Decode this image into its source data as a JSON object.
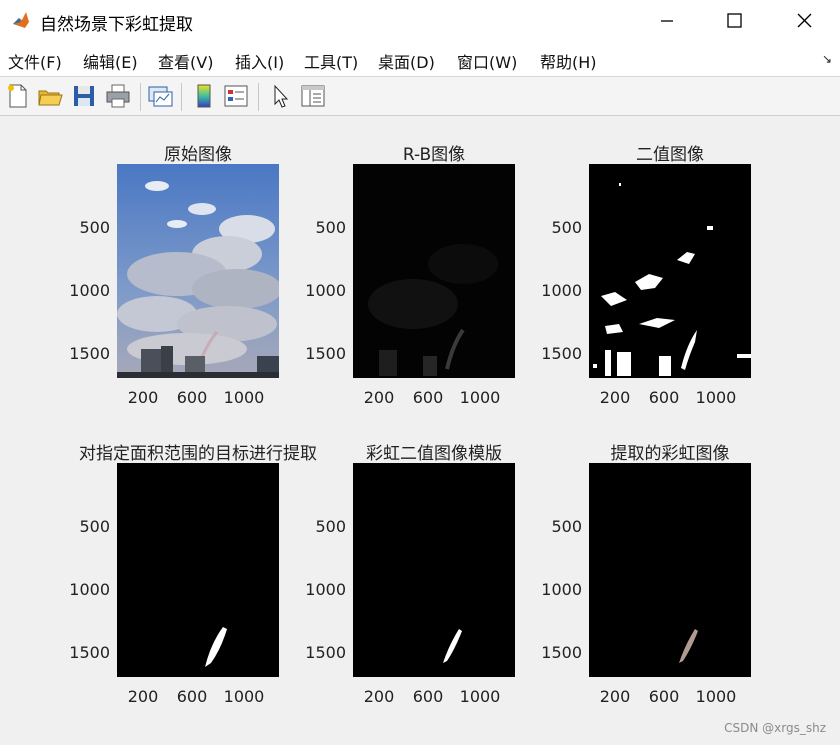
{
  "window": {
    "title": "自然场景下彩虹提取",
    "minimize_icon": "minimize-icon",
    "maximize_icon": "maximize-icon",
    "close_icon": "close-icon"
  },
  "menu": {
    "items": [
      {
        "label": "文件(F)"
      },
      {
        "label": "编辑(E)"
      },
      {
        "label": "查看(V)"
      },
      {
        "label": "插入(I)"
      },
      {
        "label": "工具(T)"
      },
      {
        "label": "桌面(D)"
      },
      {
        "label": "窗口(W)"
      },
      {
        "label": "帮助(H)"
      }
    ],
    "overflow_arrow": "↘"
  },
  "toolbar": {
    "buttons": [
      "new-figure-icon",
      "open-folder-icon",
      "save-icon",
      "print-icon",
      "link-plot-icon",
      "colorbar-icon",
      "legend-icon",
      "pointer-icon",
      "property-editor-icon"
    ]
  },
  "axes": {
    "yticks": [
      "500",
      "1000",
      "1500"
    ],
    "xticks": [
      "200",
      "600",
      "1000"
    ]
  },
  "panels": [
    {
      "title": "原始图像"
    },
    {
      "title": "R-B图像"
    },
    {
      "title": "二值图像"
    },
    {
      "title": "对指定面积范围的目标进行提取"
    },
    {
      "title": "彩虹二值图像模版"
    },
    {
      "title": "提取的彩虹图像"
    }
  ],
  "watermark": "CSDN @xrgs_shz",
  "colors": {
    "title_bar": "#ffffff",
    "figure_bg": "#f0f0f0",
    "sky": "#5b86c6",
    "cloud": "#e6e8ee",
    "rainbow_extracted": "#b09a92"
  }
}
